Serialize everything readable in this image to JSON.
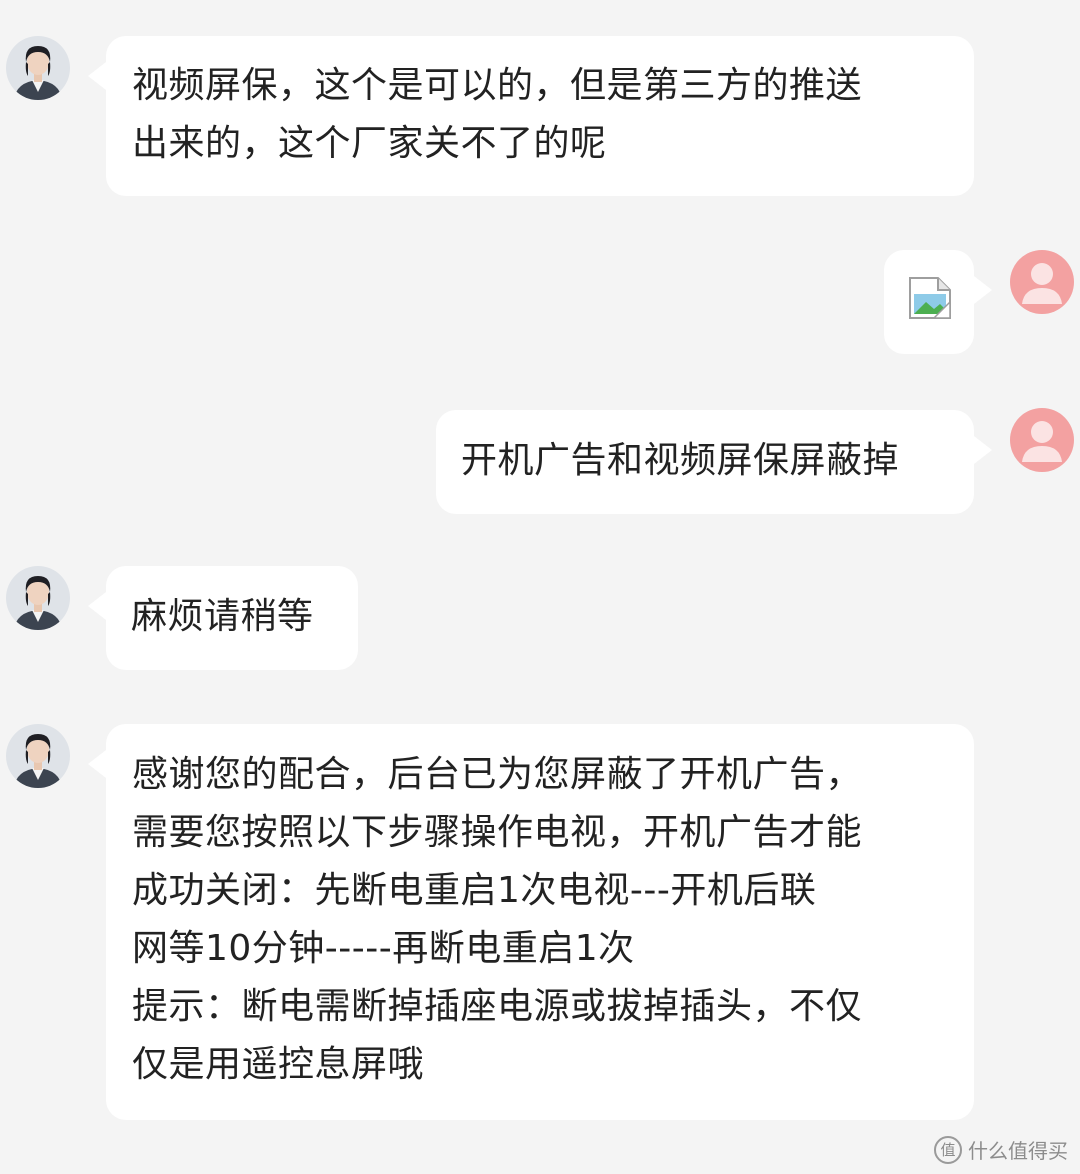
{
  "messages": [
    {
      "side": "left",
      "sender": "agent",
      "lines": [
        "视频屏保，这个是可以的，但是第三方的推送",
        "出来的，这个厂家关不了的呢"
      ]
    },
    {
      "side": "right",
      "sender": "user",
      "type": "image",
      "icon": "broken-image-icon"
    },
    {
      "side": "right",
      "sender": "user",
      "lines": [
        "开机广告和视频屏保屏蔽掉"
      ]
    },
    {
      "side": "left",
      "sender": "agent",
      "lines": [
        "麻烦请稍等"
      ]
    },
    {
      "side": "left",
      "sender": "agent",
      "lines": [
        "感谢您的配合，后台已为您屏蔽了开机广告，",
        "需要您按照以下步骤操作电视，开机广告才能",
        "成功关闭：先断电重启1次电视---开机后联",
        "网等10分钟-----再断电重启1次",
        "提示：断电需断掉插座电源或拔掉插头，不仅",
        "仅是用遥控息屏哦"
      ]
    }
  ],
  "watermark": {
    "badge": "值",
    "text": "什么值得买"
  },
  "colors": {
    "background": "#f4f4f4",
    "bubble": "#ffffff",
    "user_avatar": "#f3a1a1",
    "text": "#222222"
  }
}
